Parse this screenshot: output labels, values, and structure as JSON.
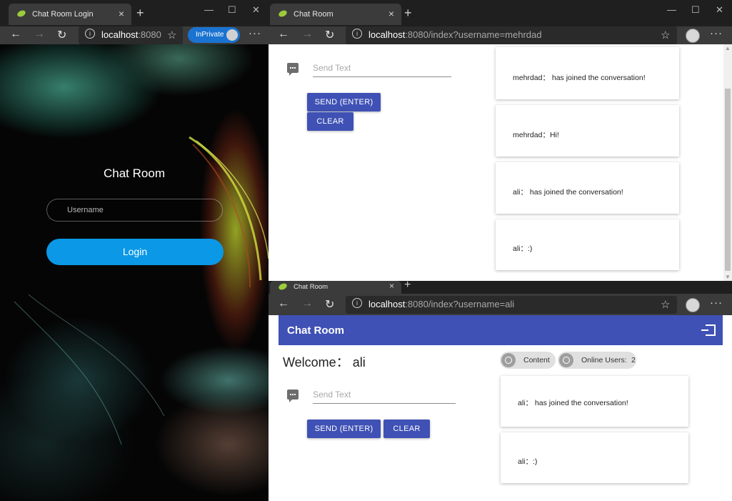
{
  "login_window": {
    "tab_title": "Chat Room Login",
    "url_host": "localhost",
    "url_rest": ":8080",
    "inprivate": "InPrivate",
    "page": {
      "title": "Chat Room",
      "username_placeholder": "Username",
      "login_label": "Login"
    }
  },
  "top_window": {
    "tab_title": "Chat Room",
    "url_host": "localhost",
    "url_rest": ":8080/index?username=mehrdad",
    "send_placeholder": "Send Text",
    "send_label": "SEND (ENTER)",
    "clear_label": "CLEAR",
    "messages": [
      "mehrdad：  has joined the conversation!",
      "mehrdad：Hi!",
      "ali：  has joined the conversation!",
      "ali：:)"
    ]
  },
  "bottom_window": {
    "tab_title": "Chat Room",
    "url_host": "localhost",
    "url_rest": ":8080/index?username=ali",
    "app_title": "Chat Room",
    "welcome": "Welcome：  ali",
    "content_chip": "Content",
    "online_chip": "Online Users:",
    "online_count": "2",
    "send_placeholder": "Send Text",
    "send_label": "SEND (ENTER)",
    "clear_label": "CLEAR",
    "messages": [
      "ali：  has joined the conversation!",
      "ali：:)"
    ]
  },
  "colors": {
    "primary": "#3f51b5",
    "login_button": "#0b98e6",
    "inprivate_badge": "#1a73d0"
  },
  "browser_ui": {
    "new_tab": "+",
    "close_tab": "×",
    "back": "←",
    "forward": "→",
    "refresh": "↻",
    "info": "i",
    "favorite": "☆",
    "more": "···",
    "minimize": "—",
    "maximize": "☐",
    "close_window": "✕"
  }
}
